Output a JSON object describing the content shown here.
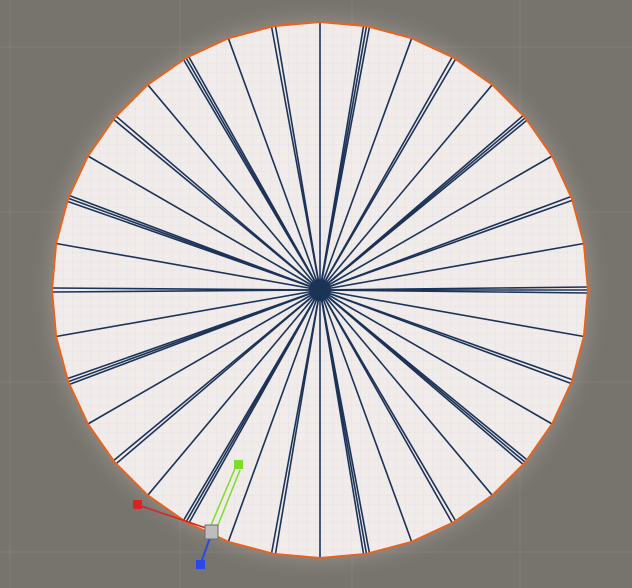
{
  "scene": {
    "background_color": "#77736d",
    "grid_color": "#827e77",
    "glow_color": "#c8c3bb"
  },
  "mesh": {
    "name": "circle-mesh",
    "selected": true,
    "face_color": "#f1ecea",
    "inner_grid_color": "#d8d8e6",
    "outline_color": "#e8641e",
    "spoke_color": "#1c3358",
    "hub_color": "#1c3358",
    "polygon_sides": 36
  },
  "gizmo": {
    "x_axis_color": "#e02020",
    "y_axis_color": "#7edc2a",
    "z_axis_color": "#2848e8",
    "center_color": "#bdbdbd"
  }
}
